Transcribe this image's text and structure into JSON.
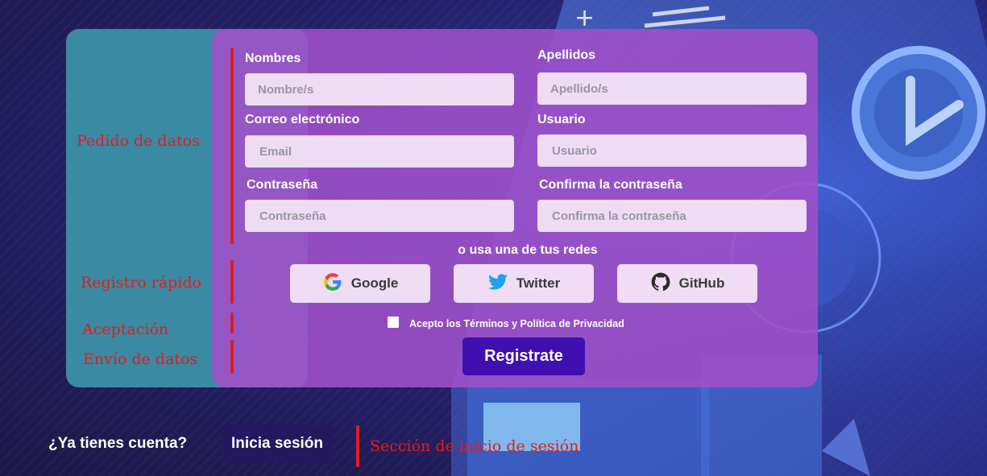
{
  "annotations": {
    "data_request": "Pedido de datos",
    "quick_register": "Registro rápido",
    "acceptance": "Aceptación",
    "data_submit": "Envío de datos",
    "login_section": "Sección de inicio de sesión"
  },
  "form": {
    "first_name": {
      "label": "Nombres",
      "placeholder": "Nombre/s"
    },
    "last_name": {
      "label": "Apellidos",
      "placeholder": "Apellido/s"
    },
    "email": {
      "label": "Correo electrónico",
      "placeholder": "Email"
    },
    "username": {
      "label": "Usuario",
      "placeholder": "Usuario"
    },
    "password": {
      "label": "Contraseña",
      "placeholder": "Contraseña"
    },
    "confirm_password": {
      "label": "Confirma la contraseña",
      "placeholder": "Confirma la contraseña"
    }
  },
  "social": {
    "title": "o usa una de tus redes",
    "buttons": [
      {
        "label": "Google",
        "icon": "google-icon"
      },
      {
        "label": "Twitter",
        "icon": "twitter-icon"
      },
      {
        "label": "GitHub",
        "icon": "github-icon"
      }
    ]
  },
  "terms": {
    "label": "Acepto los Términos y Política de Privacidad",
    "checked": false
  },
  "submit": {
    "label": "Registrate"
  },
  "login": {
    "prompt": "¿Ya tienes cuenta?",
    "button": "Inicia sesión"
  },
  "colors": {
    "card": "#a050c8",
    "annotation_panel": "#3a8aa3",
    "annotation_text": "#e41b1b",
    "submit_button": "#3f0fb0",
    "login_button": "#25185e"
  }
}
